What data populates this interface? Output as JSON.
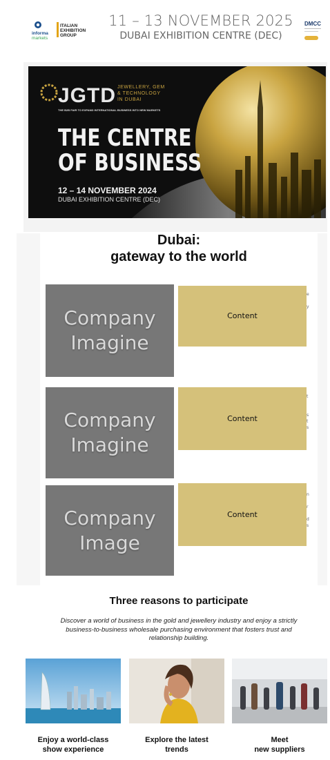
{
  "header": {
    "informa_logo": "informa markets",
    "ieg_logo": "ITALIAN EXHIBITION GROUP",
    "dates": "11 – 13 NOVEMBER 2025",
    "venue": "DUBAI EXHIBITION CENTRE (DEC)",
    "dmcc_logo": "DMCC"
  },
  "banner": {
    "brand": "JGTD",
    "brand_tagline_1": "JEWELLERY, GEM",
    "brand_tagline_2": "& TECHNOLOGY",
    "brand_tagline_3": "IN DUBAI",
    "strapline": "THE B2B FAIR TO EXPAND INTERNATIONAL BUSINESS INTO NEW MARKETS",
    "headline_1": "THE CENTRE",
    "headline_2": "OF BUSINESS",
    "dates": "12 – 14 NOVEMBER 2024",
    "venue": "DUBAI EXHIBITION CENTRE (DEC)"
  },
  "section": {
    "title_line1": "Dubai:",
    "title_line2": "gateway to the world"
  },
  "cards": [
    {
      "image_line1": "Company",
      "image_line2": "Imagine",
      "content": "Content",
      "edge": [
        "e",
        "",
        "y"
      ]
    },
    {
      "image_line1": "Company",
      "image_line2": "Imagine",
      "content": "Content",
      "edge": [
        "t",
        "",
        "",
        "s",
        "t",
        "s"
      ]
    },
    {
      "image_line1": "Company",
      "image_line2": "Image",
      "content": "Content",
      "edge": [
        "n",
        "",
        "r",
        "",
        "d",
        "s"
      ]
    }
  ],
  "reasons": {
    "title": "Three reasons to participate",
    "description": "Discover a world of business in the gold and jewellery industry and enjoy a strictly business-to-business wholesale purchasing environment that fosters trust and relationship building.",
    "items": [
      {
        "label_line1": "Enjoy a world-class",
        "label_line2": "show experience",
        "icon": "dubai-skyline-photo"
      },
      {
        "label_line1": "Explore the latest",
        "label_line2": "trends",
        "icon": "woman-jewellery-photo"
      },
      {
        "label_line1": "Meet",
        "label_line2": "new suppliers",
        "icon": "expo-crowd-photo"
      }
    ]
  },
  "colors": {
    "gold": "#d5c17a",
    "placeholder_gray": "#777777",
    "banner_bg": "#0e0e0e"
  }
}
